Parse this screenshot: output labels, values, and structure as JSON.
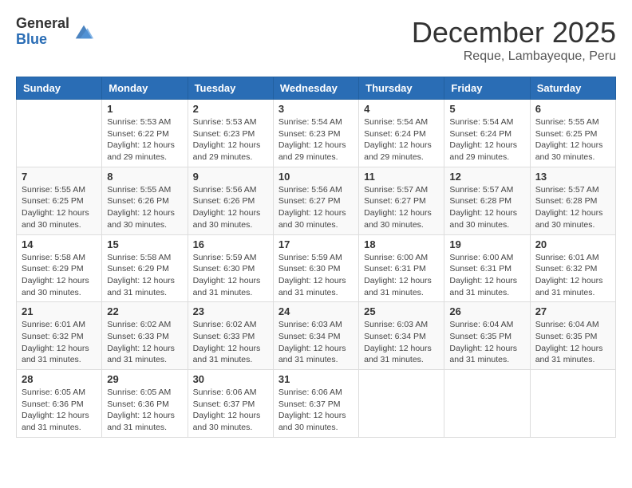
{
  "header": {
    "logo_general": "General",
    "logo_blue": "Blue",
    "month_title": "December 2025",
    "subtitle": "Reque, Lambayeque, Peru"
  },
  "weekdays": [
    "Sunday",
    "Monday",
    "Tuesday",
    "Wednesday",
    "Thursday",
    "Friday",
    "Saturday"
  ],
  "weeks": [
    [
      {
        "day": "",
        "info": ""
      },
      {
        "day": "1",
        "info": "Sunrise: 5:53 AM\nSunset: 6:22 PM\nDaylight: 12 hours\nand 29 minutes."
      },
      {
        "day": "2",
        "info": "Sunrise: 5:53 AM\nSunset: 6:23 PM\nDaylight: 12 hours\nand 29 minutes."
      },
      {
        "day": "3",
        "info": "Sunrise: 5:54 AM\nSunset: 6:23 PM\nDaylight: 12 hours\nand 29 minutes."
      },
      {
        "day": "4",
        "info": "Sunrise: 5:54 AM\nSunset: 6:24 PM\nDaylight: 12 hours\nand 29 minutes."
      },
      {
        "day": "5",
        "info": "Sunrise: 5:54 AM\nSunset: 6:24 PM\nDaylight: 12 hours\nand 29 minutes."
      },
      {
        "day": "6",
        "info": "Sunrise: 5:55 AM\nSunset: 6:25 PM\nDaylight: 12 hours\nand 30 minutes."
      }
    ],
    [
      {
        "day": "7",
        "info": "Sunrise: 5:55 AM\nSunset: 6:25 PM\nDaylight: 12 hours\nand 30 minutes."
      },
      {
        "day": "8",
        "info": "Sunrise: 5:55 AM\nSunset: 6:26 PM\nDaylight: 12 hours\nand 30 minutes."
      },
      {
        "day": "9",
        "info": "Sunrise: 5:56 AM\nSunset: 6:26 PM\nDaylight: 12 hours\nand 30 minutes."
      },
      {
        "day": "10",
        "info": "Sunrise: 5:56 AM\nSunset: 6:27 PM\nDaylight: 12 hours\nand 30 minutes."
      },
      {
        "day": "11",
        "info": "Sunrise: 5:57 AM\nSunset: 6:27 PM\nDaylight: 12 hours\nand 30 minutes."
      },
      {
        "day": "12",
        "info": "Sunrise: 5:57 AM\nSunset: 6:28 PM\nDaylight: 12 hours\nand 30 minutes."
      },
      {
        "day": "13",
        "info": "Sunrise: 5:57 AM\nSunset: 6:28 PM\nDaylight: 12 hours\nand 30 minutes."
      }
    ],
    [
      {
        "day": "14",
        "info": "Sunrise: 5:58 AM\nSunset: 6:29 PM\nDaylight: 12 hours\nand 30 minutes."
      },
      {
        "day": "15",
        "info": "Sunrise: 5:58 AM\nSunset: 6:29 PM\nDaylight: 12 hours\nand 31 minutes."
      },
      {
        "day": "16",
        "info": "Sunrise: 5:59 AM\nSunset: 6:30 PM\nDaylight: 12 hours\nand 31 minutes."
      },
      {
        "day": "17",
        "info": "Sunrise: 5:59 AM\nSunset: 6:30 PM\nDaylight: 12 hours\nand 31 minutes."
      },
      {
        "day": "18",
        "info": "Sunrise: 6:00 AM\nSunset: 6:31 PM\nDaylight: 12 hours\nand 31 minutes."
      },
      {
        "day": "19",
        "info": "Sunrise: 6:00 AM\nSunset: 6:31 PM\nDaylight: 12 hours\nand 31 minutes."
      },
      {
        "day": "20",
        "info": "Sunrise: 6:01 AM\nSunset: 6:32 PM\nDaylight: 12 hours\nand 31 minutes."
      }
    ],
    [
      {
        "day": "21",
        "info": "Sunrise: 6:01 AM\nSunset: 6:32 PM\nDaylight: 12 hours\nand 31 minutes."
      },
      {
        "day": "22",
        "info": "Sunrise: 6:02 AM\nSunset: 6:33 PM\nDaylight: 12 hours\nand 31 minutes."
      },
      {
        "day": "23",
        "info": "Sunrise: 6:02 AM\nSunset: 6:33 PM\nDaylight: 12 hours\nand 31 minutes."
      },
      {
        "day": "24",
        "info": "Sunrise: 6:03 AM\nSunset: 6:34 PM\nDaylight: 12 hours\nand 31 minutes."
      },
      {
        "day": "25",
        "info": "Sunrise: 6:03 AM\nSunset: 6:34 PM\nDaylight: 12 hours\nand 31 minutes."
      },
      {
        "day": "26",
        "info": "Sunrise: 6:04 AM\nSunset: 6:35 PM\nDaylight: 12 hours\nand 31 minutes."
      },
      {
        "day": "27",
        "info": "Sunrise: 6:04 AM\nSunset: 6:35 PM\nDaylight: 12 hours\nand 31 minutes."
      }
    ],
    [
      {
        "day": "28",
        "info": "Sunrise: 6:05 AM\nSunset: 6:36 PM\nDaylight: 12 hours\nand 31 minutes."
      },
      {
        "day": "29",
        "info": "Sunrise: 6:05 AM\nSunset: 6:36 PM\nDaylight: 12 hours\nand 31 minutes."
      },
      {
        "day": "30",
        "info": "Sunrise: 6:06 AM\nSunset: 6:37 PM\nDaylight: 12 hours\nand 30 minutes."
      },
      {
        "day": "31",
        "info": "Sunrise: 6:06 AM\nSunset: 6:37 PM\nDaylight: 12 hours\nand 30 minutes."
      },
      {
        "day": "",
        "info": ""
      },
      {
        "day": "",
        "info": ""
      },
      {
        "day": "",
        "info": ""
      }
    ]
  ]
}
